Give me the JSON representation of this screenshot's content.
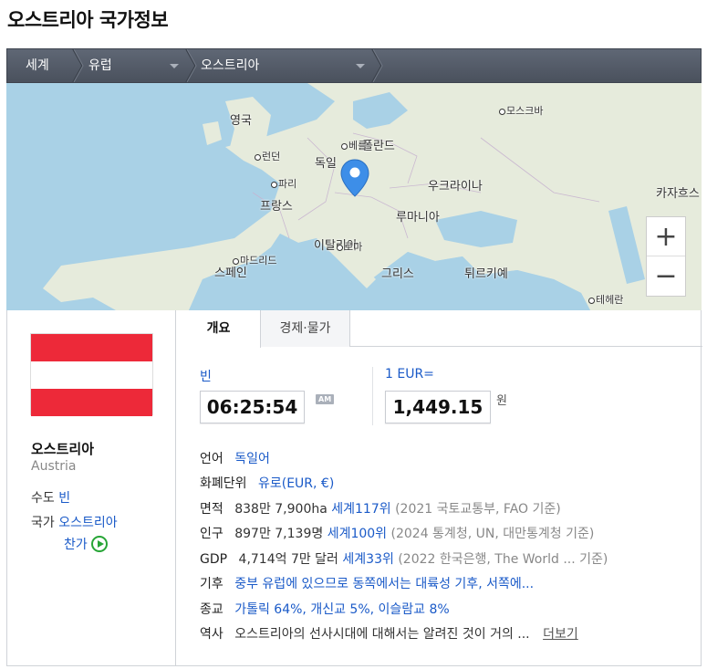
{
  "page": {
    "title": "오스트리아 국가정보"
  },
  "breadcrumb": {
    "items": [
      "세계",
      "유럽",
      "오스트리아"
    ]
  },
  "map": {
    "labels": {
      "uk": "영국",
      "france": "프랑스",
      "germany": "독일",
      "poland": "폴란드",
      "ukraine": "우크라이나",
      "romania": "루마니아",
      "italy": "이탈리아",
      "spain": "스페인",
      "greece": "그리스",
      "turkey": "튀르키예",
      "kazakhstan": "카자흐스"
    },
    "cities": {
      "moscow": "모스크바",
      "london": "런던",
      "paris": "파리",
      "madrid": "마드리드",
      "tehran": "테헤란",
      "berlin": "베를",
      "rome": "로마"
    },
    "zoom_in": "+",
    "zoom_out": "−",
    "colors": {
      "sea": "#a9d1e6",
      "land": "#e6ebdc",
      "pin": "#3d8ee8"
    }
  },
  "country": {
    "name_ko": "오스트리아",
    "name_en": "Austria",
    "capital_label": "수도",
    "capital": "빈",
    "anthem_label": "국가",
    "anthem_name": "오스트리아",
    "anthem_suffix": "찬가",
    "flag_colors": [
      "#ed2939",
      "#ffffff",
      "#ed2939"
    ]
  },
  "tabs": [
    {
      "label": "개요",
      "active": true
    },
    {
      "label": "경제·물가",
      "active": false
    }
  ],
  "clock": {
    "city": "빈",
    "time": "06:25:54",
    "ampm": "AM"
  },
  "currency": {
    "label": "1 EUR=",
    "value": "1,449.15",
    "unit": "원"
  },
  "info": [
    {
      "key": "언어",
      "value": "독일어"
    },
    {
      "key": "화폐단위",
      "value": "유로(EUR, €)"
    },
    {
      "key": "면적",
      "value": "838만 7,900ha",
      "rank": "세계117위",
      "source": "(2021 국토교통부, FAO 기준)"
    },
    {
      "key": "인구",
      "value": "897만 7,139명",
      "rank": "세계100위",
      "source": "(2024 통계청, UN, 대만통계청 기준)"
    },
    {
      "key": "GDP",
      "value": "4,714억 7만 달러",
      "rank": "세계33위",
      "source": "(2022 한국은행, The World ...",
      "source_tail": "기준)"
    },
    {
      "key": "기후",
      "value": "중부 유럽에 있으므로 동쪽에서는 대륙성 기후, 서쪽에..."
    },
    {
      "key": "종교",
      "value": "가톨릭 64%, 개신교 5%, 이슬람교 8%"
    },
    {
      "key": "역사",
      "value": "오스트리아의 선사시대에 대해서는 알려진 것이 거의 ...",
      "more": "더보기"
    }
  ]
}
